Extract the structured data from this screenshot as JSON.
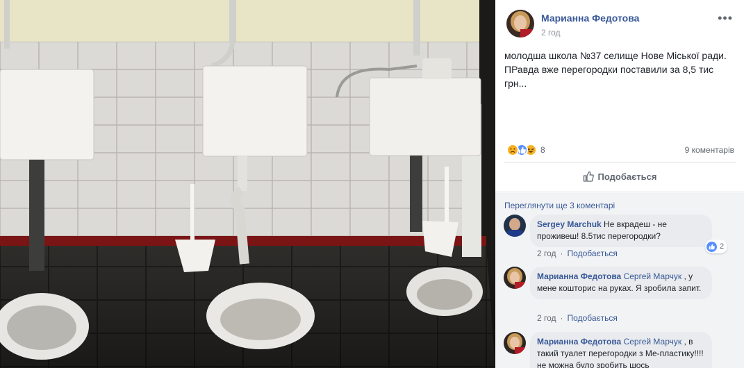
{
  "post": {
    "author": "Марианна Федотова",
    "time": "2 год",
    "text": "молодша школа №37 селище Нове Міської ради. ПРавда вже перегородки поставили за 8,5 тис грн...",
    "reactions": [
      "sad-reaction-icon",
      "like-reaction-icon",
      "haha-reaction-icon"
    ],
    "reactions_count": "8",
    "comments_count": "9 коментарів",
    "like_action": "Подобається",
    "view_more": "Переглянути ще 3 коментарі"
  },
  "comments": [
    {
      "name": "Sergey Marchuk",
      "tag": "",
      "text": " Не вкрадеш - не проживеш! 8.5тис перегородки?",
      "time": "2 год",
      "like": "Подобається",
      "likes": "2"
    },
    {
      "name": "Марианна Федотова",
      "tag": "Сергей Марчук",
      "text": " , у мене кошторис на руках. Я зробила запит.",
      "time": "2 год",
      "like": "Подобається"
    },
    {
      "name": "Марианна Федотова",
      "tag": "Сергей Марчук",
      "text": " , в такий туалет перегородки з Ме-пластику!!!! не можна було зробить шось",
      "time": "",
      "like": ""
    }
  ],
  "colors": {
    "link": "#385898",
    "text": "#1d2129",
    "muted": "#606770",
    "like_blue": "#5890ff",
    "comment_bg": "#f2f3f5",
    "bubble_bg": "#e9ebee"
  },
  "icons": {
    "more": "more-options-icon",
    "like_action": "thumbs-up-icon"
  }
}
